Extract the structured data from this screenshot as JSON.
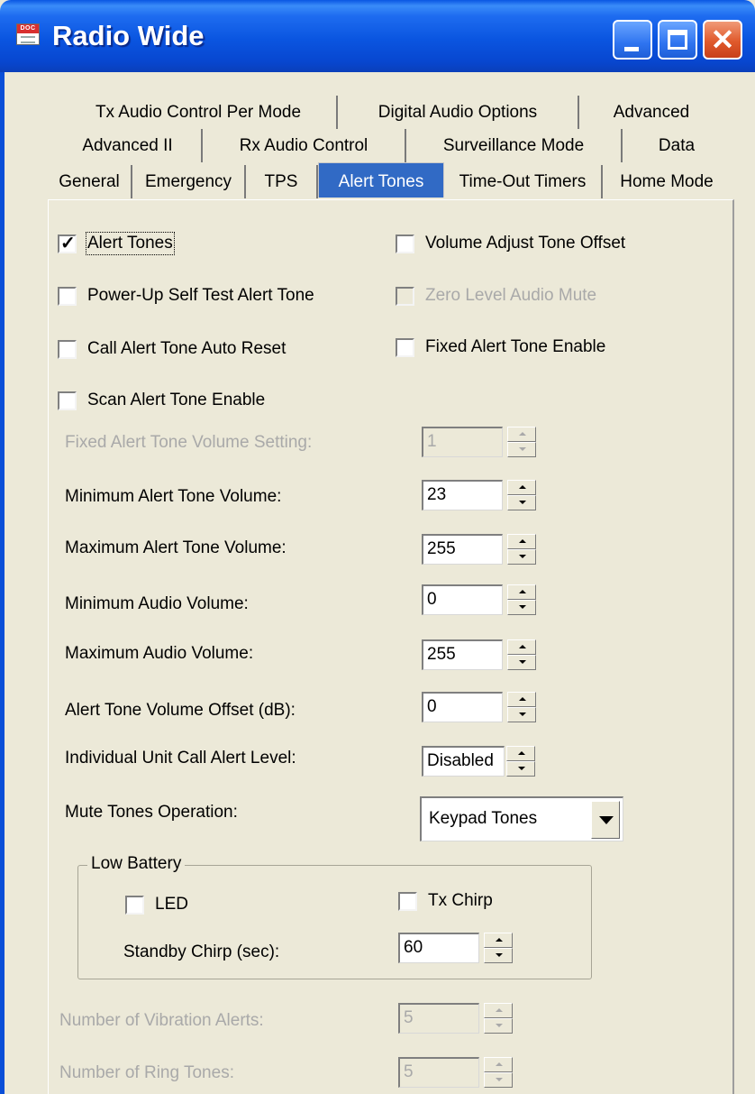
{
  "window": {
    "title": "Radio Wide",
    "icon": "doc-icon",
    "icon_text": "DOC"
  },
  "tabs": {
    "row1": [
      "Tx Audio Control Per Mode",
      "Digital Audio Options",
      "Advanced"
    ],
    "row2": [
      "Advanced II",
      "Rx Audio Control",
      "Surveillance Mode",
      "Data"
    ],
    "row3": [
      "General",
      "Emergency",
      "TPS",
      "Alert Tones",
      "Time-Out Timers",
      "Home Mode"
    ],
    "active": "Alert Tones"
  },
  "checkboxes": {
    "alert_tones": {
      "label": "Alert Tones",
      "checked": true
    },
    "volume_adjust_tone_offset": {
      "label": "Volume Adjust Tone Offset",
      "checked": false
    },
    "power_up_self_test": {
      "label": "Power-Up Self Test Alert Tone",
      "checked": false
    },
    "zero_level_audio_mute": {
      "label": "Zero Level Audio Mute",
      "checked": false,
      "disabled": true
    },
    "call_alert_auto_reset": {
      "label": "Call Alert Tone Auto Reset",
      "checked": false
    },
    "fixed_alert_tone_enable": {
      "label": "Fixed Alert Tone Enable",
      "checked": false
    },
    "scan_alert_tone_enable": {
      "label": "Scan Alert Tone Enable",
      "checked": false
    }
  },
  "fields": {
    "fixed_alert_tone_volume": {
      "label": "Fixed Alert Tone Volume Setting:",
      "value": "1",
      "disabled": true
    },
    "min_alert_tone_volume": {
      "label": "Minimum Alert Tone Volume:",
      "value": "23"
    },
    "max_alert_tone_volume": {
      "label": "Maximum Alert Tone Volume:",
      "value": "255"
    },
    "min_audio_volume": {
      "label": "Minimum Audio Volume:",
      "value": "0"
    },
    "max_audio_volume": {
      "label": "Maximum Audio Volume:",
      "value": "255"
    },
    "alert_tone_volume_offset": {
      "label": "Alert Tone Volume Offset (dB):",
      "value": "0"
    },
    "individual_call_alert_level": {
      "label": "Individual Unit Call Alert Level:",
      "value": "Disabled"
    },
    "mute_tones_operation": {
      "label": "Mute Tones Operation:",
      "value": "Keypad Tones"
    }
  },
  "low_battery": {
    "legend": "Low Battery",
    "led": {
      "label": "LED",
      "checked": false
    },
    "tx_chirp": {
      "label": "Tx Chirp",
      "checked": false
    },
    "standby_chirp": {
      "label": "Standby Chirp (sec):",
      "value": "60"
    }
  },
  "vibration": {
    "num_vibration_alerts": {
      "label": "Number of Vibration Alerts:",
      "value": "5",
      "disabled": true
    },
    "num_ring_tones": {
      "label": "Number of Ring Tones:",
      "value": "5",
      "disabled": true
    }
  }
}
